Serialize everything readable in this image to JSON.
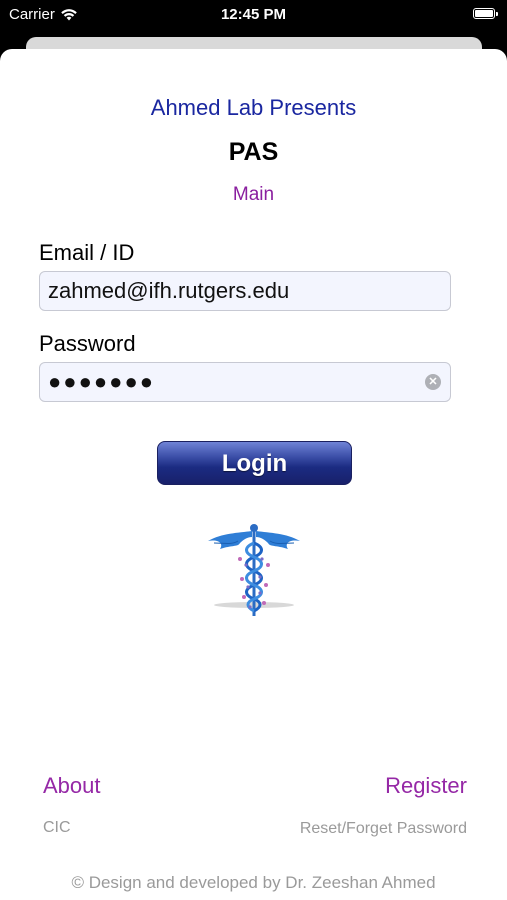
{
  "status_bar": {
    "carrier": "Carrier",
    "time": "12:45 PM",
    "wifi_icon": "wifi-icon",
    "battery_icon": "battery-icon"
  },
  "header": {
    "presents": "Ahmed Lab Presents",
    "title": "PAS",
    "subtitle": "Main"
  },
  "form": {
    "email_label": "Email / ID",
    "email_value": "zahmed@ifh.rutgers.edu",
    "password_label": "Password",
    "password_value": "●●●●●●●",
    "clear_icon": "clear-icon",
    "login_label": "Login"
  },
  "logo": {
    "icon": "caduceus-dna-logo"
  },
  "footer": {
    "about": "About",
    "register": "Register",
    "cic": "CIC",
    "reset": "Reset/Forget Password",
    "copyright": "© Design and developed by Dr. Zeeshan Ahmed"
  },
  "colors": {
    "presents": "#1a27a0",
    "subtitle": "#8a1f9f",
    "links": "#9528a6",
    "login_button": "#1b2b82",
    "muted": "#9a9a9a"
  }
}
